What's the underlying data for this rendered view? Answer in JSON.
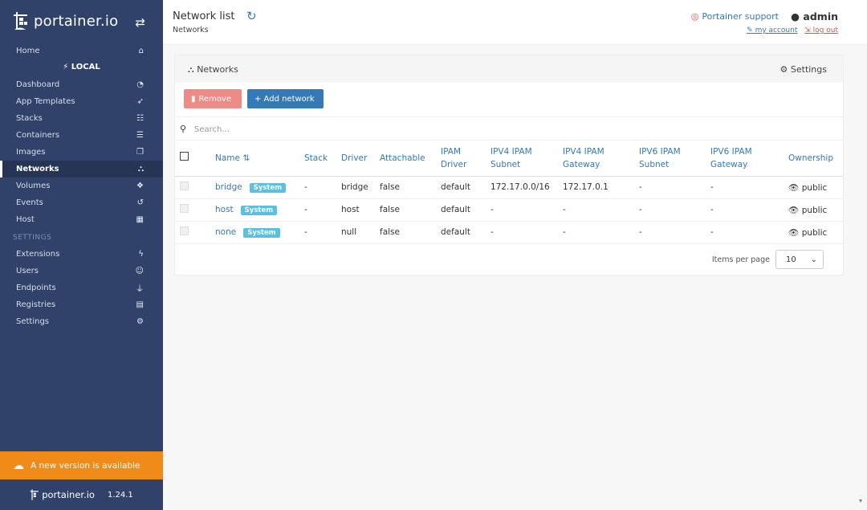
{
  "sidebar": {
    "brand": "portainer.io",
    "swap_icon": "exchange-icon",
    "home": "Home",
    "endpoint_header": "LOCAL",
    "items": [
      {
        "label": "Dashboard",
        "icon": "tachometer-icon"
      },
      {
        "label": "App Templates",
        "icon": "rocket-icon"
      },
      {
        "label": "Stacks",
        "icon": "th-list-icon"
      },
      {
        "label": "Containers",
        "icon": "server-icon"
      },
      {
        "label": "Images",
        "icon": "clone-icon"
      },
      {
        "label": "Networks",
        "icon": "sitemap-icon",
        "active": true
      },
      {
        "label": "Volumes",
        "icon": "cubes-icon"
      },
      {
        "label": "Events",
        "icon": "history-icon"
      },
      {
        "label": "Host",
        "icon": "th-icon"
      }
    ],
    "settings_header": "SETTINGS",
    "settings_items": [
      {
        "label": "Extensions",
        "icon": "bolt-icon"
      },
      {
        "label": "Users",
        "icon": "users-icon"
      },
      {
        "label": "Endpoints",
        "icon": "plug-icon"
      },
      {
        "label": "Registries",
        "icon": "database-icon"
      },
      {
        "label": "Settings",
        "icon": "cogs-icon"
      }
    ],
    "update_notice": "A new version is available",
    "footer_brand": "portainer.io",
    "version": "1.24.1"
  },
  "header": {
    "title": "Network list",
    "breadcrumb": "Networks",
    "support": "Portainer support",
    "user": "admin",
    "my_account": "my account",
    "log_out": "log out"
  },
  "panel": {
    "title": "Networks",
    "settings": "Settings",
    "remove_label": "Remove",
    "add_label": "+ Add network",
    "search_placeholder": "Search..."
  },
  "table": {
    "columns": [
      "Name",
      "Stack",
      "Driver",
      "Attachable",
      "IPAM Driver",
      "IPV4 IPAM Subnet",
      "IPV4 IPAM Gateway",
      "IPV6 IPAM Subnet",
      "IPV6 IPAM Gateway",
      "Ownership"
    ],
    "rows": [
      {
        "name": "bridge",
        "badge": "System",
        "stack": "-",
        "driver": "bridge",
        "attachable": "false",
        "ipam_driver": "default",
        "ipv4_subnet": "172.17.0.0/16",
        "ipv4_gateway": "172.17.0.1",
        "ipv6_subnet": "-",
        "ipv6_gateway": "-",
        "ownership": "public"
      },
      {
        "name": "host",
        "badge": "System",
        "stack": "-",
        "driver": "host",
        "attachable": "false",
        "ipam_driver": "default",
        "ipv4_subnet": "-",
        "ipv4_gateway": "-",
        "ipv6_subnet": "-",
        "ipv6_gateway": "-",
        "ownership": "public"
      },
      {
        "name": "none",
        "badge": "System",
        "stack": "-",
        "driver": "null",
        "attachable": "false",
        "ipam_driver": "default",
        "ipv4_subnet": "-",
        "ipv4_gateway": "-",
        "ipv6_subnet": "-",
        "ipv6_gateway": "-",
        "ownership": "public"
      }
    ]
  },
  "pagination": {
    "label": "Items per page",
    "value": "10"
  },
  "colors": {
    "sidebar_bg": "#30426a",
    "accent": "#337ab7",
    "update_bar": "#f08a19",
    "remove_button": "#ee8b87",
    "system_badge": "#5bc0de"
  }
}
